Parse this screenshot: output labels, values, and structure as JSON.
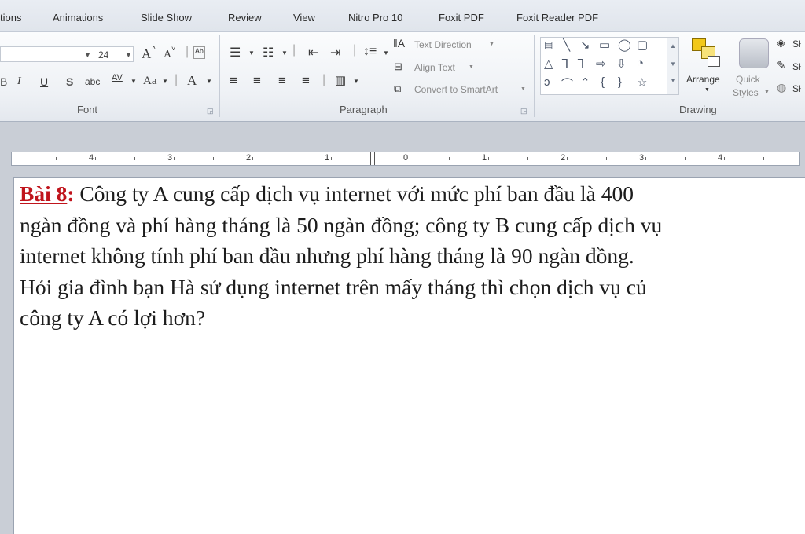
{
  "tabs": [
    "tions",
    "Animations",
    "Slide Show",
    "Review",
    "View",
    "Nitro Pro 10",
    "Foxit PDF",
    "Foxit Reader PDF"
  ],
  "font_group": {
    "label": "Font",
    "size_value": "24",
    "bold_grow": "A",
    "shrink": "A",
    "italic": "I",
    "underline": "U",
    "shadow": "S",
    "strike": "abc",
    "spacing": "AV",
    "change_case": "Aa",
    "color": "A"
  },
  "paragraph_group": {
    "label": "Paragraph",
    "text_direction": "Text Direction",
    "align_text": "Align Text",
    "convert_smartart": "Convert to SmartArt"
  },
  "drawing_group": {
    "label": "Drawing",
    "arrange": "Arrange",
    "quick_styles_1": "Quick",
    "quick_styles_2": "Styles",
    "extra_1": "Sł",
    "extra_2": "Sł",
    "extra_3": "Sł"
  },
  "ruler": {
    "marks": [
      "4",
      "3",
      "2",
      "1",
      "0",
      "1",
      "2",
      "3",
      "4"
    ]
  },
  "slide": {
    "heading": "Bài 8",
    "colon": ":",
    "line1": " Công ty A cung cấp dịch vụ internet với mức phí ban đầu là 400",
    "line2": "ngàn đồng và phí hàng tháng là 50 ngàn đồng; công ty B cung cấp dịch vụ",
    "line3": "internet không tính phí ban đầu nhưng phí hàng tháng là 90 ngàn đồng.",
    "line4": "Hỏi gia đình bạn Hà sử dụng internet trên mấy tháng thì chọn dịch vụ củ",
    "line5": "công ty A có lợi hơn?"
  },
  "colors": {
    "heading_red": "#c0141c",
    "ribbon_bg": "#eef1f5",
    "workspace": "#c9ced6"
  }
}
